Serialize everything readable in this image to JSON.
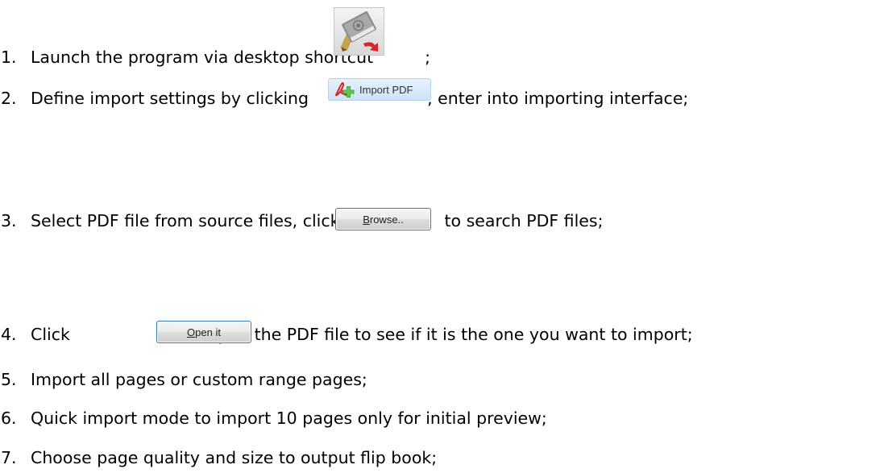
{
  "steps": [
    {
      "num": "1.",
      "text": "Launch the program via desktop shortcut",
      "after": ";"
    },
    {
      "num": "2.",
      "text": "Define import settings by clicking",
      "after": ", enter into importing interface;"
    },
    {
      "num": "3.",
      "text": "Select PDF file from source files, click",
      "after": "to search PDF files;"
    },
    {
      "num": "4.",
      "text": "Click",
      "after": "to open the PDF file to see if it is the one you want to import;"
    },
    {
      "num": "5.",
      "text": "Import all pages or custom range pages;"
    },
    {
      "num": "6.",
      "text": "Quick import mode to import 10 pages only for initial preview;"
    },
    {
      "num": "7.",
      "text": "Choose page quality and size to output flip book;"
    }
  ],
  "buttons": {
    "import_pdf": {
      "accel": "I",
      "rest": "mport PDF"
    },
    "browse": {
      "accel": "B",
      "rest": "rowse.."
    },
    "open_it": {
      "accel": "O",
      "rest": "pen it"
    }
  },
  "icons": {
    "program": "flipbook-program-icon",
    "import": "pdf-plus-icon"
  },
  "colors": {
    "text": "#000000",
    "import_bg": "#d6e8f8",
    "pdf_red": "#d6262b",
    "plus_green": "#3fa535"
  }
}
